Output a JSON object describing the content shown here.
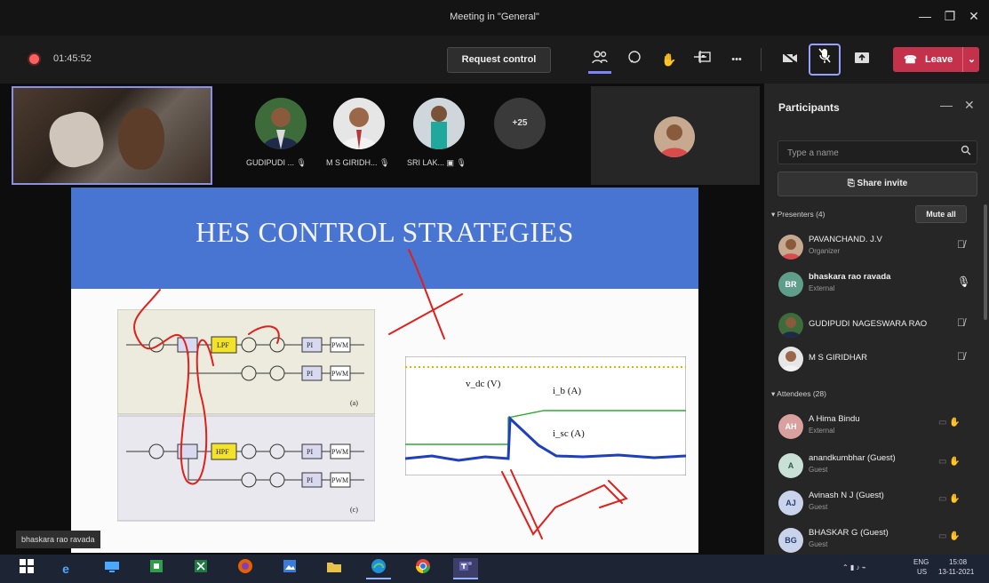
{
  "window": {
    "title": "Meeting in \"General\"",
    "minimize": "—",
    "maximize": "❐",
    "close": "✕"
  },
  "toolbar": {
    "timer": "01:45:52",
    "request_control": "Request control",
    "leave": "Leave",
    "more": "•••"
  },
  "tiles": [
    {
      "name": "GUDIPUDI ...",
      "status": "🎙"
    },
    {
      "name": "M S GIRIDH...",
      "status": "🎙"
    },
    {
      "name": "SRI LAK...",
      "status": "▣ 🎙"
    }
  ],
  "overflow_count": "+25",
  "slide": {
    "title": "HES CONTROL STRATEGIES",
    "diagram_labels": {
      "lpf": "LPF",
      "hpf": "HPF",
      "pi1": "PI",
      "pwm1": "PWM",
      "pi2": "PI",
      "pwm2": "PWM",
      "pi3": "PI",
      "pwm3": "PWM",
      "pi4": "PI",
      "pwm4": "PWM",
      "sub_a": "(a)",
      "sub_c": "(c)"
    },
    "waveform_labels": {
      "vdc": "v_dc (V)",
      "ib": "i_b (A)",
      "isc": "i_sc (A)"
    }
  },
  "speaker_label": "bhaskara rao ravada",
  "participants": {
    "title": "Participants",
    "search_placeholder": "Type a name",
    "share_invite": "Share invite",
    "presenters_header": "Presenters (4)",
    "mute_all": "Mute all",
    "attendees_header": "Attendees (28)",
    "presenters": [
      {
        "name": "PAVANCHAND. J.V",
        "sub": "Organizer",
        "initials": ""
      },
      {
        "name": "bhaskara rao ravada",
        "sub": "External",
        "initials": "BR"
      },
      {
        "name": "GUDIPUDI NAGESWARA RAO",
        "sub": "",
        "initials": ""
      },
      {
        "name": "M S GIRIDHAR",
        "sub": "",
        "initials": ""
      }
    ],
    "attendees": [
      {
        "name": "A Hima Bindu",
        "sub": "External",
        "initials": "AH"
      },
      {
        "name": "anandkumbhar (Guest)",
        "sub": "Guest",
        "initials": "A"
      },
      {
        "name": "Avinash N J (Guest)",
        "sub": "Guest",
        "initials": "AJ"
      },
      {
        "name": "BHASKAR G (Guest)",
        "sub": "Guest",
        "initials": "BG"
      }
    ]
  },
  "taskbar": {
    "lang": "ENG",
    "region": "US",
    "time": "15:08",
    "date": "13-11-2021"
  },
  "colors": {
    "leave": "#c4314b",
    "slide_header": "#4775d1",
    "accent": "#7f85f5",
    "lpf_box": "#f2e22a"
  }
}
